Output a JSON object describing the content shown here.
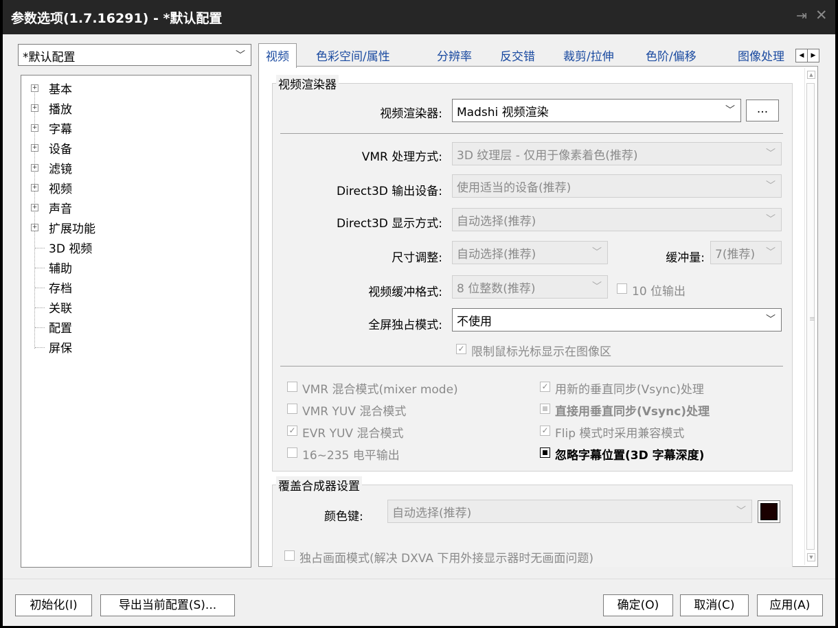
{
  "window": {
    "title": "参数选项(1.7.16291) - *默认配置",
    "pin_icon": "pin-icon",
    "close_icon": "close-icon"
  },
  "profile_select": {
    "value": "*默认配置"
  },
  "tree": {
    "items": [
      {
        "label": "基本",
        "expandable": true
      },
      {
        "label": "播放",
        "expandable": true
      },
      {
        "label": "字幕",
        "expandable": true
      },
      {
        "label": "设备",
        "expandable": true
      },
      {
        "label": "滤镜",
        "expandable": true
      },
      {
        "label": "视频",
        "expandable": true,
        "selected": true
      },
      {
        "label": "声音",
        "expandable": true
      },
      {
        "label": "扩展功能",
        "expandable": true
      },
      {
        "label": "3D 视频",
        "expandable": false
      },
      {
        "label": "辅助",
        "expandable": false
      },
      {
        "label": "存档",
        "expandable": false
      },
      {
        "label": "关联",
        "expandable": false
      },
      {
        "label": "配置",
        "expandable": false
      },
      {
        "label": "屏保",
        "expandable": false
      }
    ]
  },
  "tabs": [
    "视频",
    "色彩空间/属性",
    "分辨率",
    "反交错",
    "裁剪/拉伸",
    "色阶/偏移",
    "图像处理"
  ],
  "active_tab": "视频",
  "renderer_group": {
    "title": "视频渲染器",
    "renderer_label": "视频渲染器:",
    "renderer_value": "Madshi 视频渲染",
    "more_button": "...",
    "vmr_label": "VMR 处理方式:",
    "vmr_value": "3D 纹理层 - 仅用于像素着色(推荐)",
    "d3d_device_label": "Direct3D 输出设备:",
    "d3d_device_value": "使用适当的设备(推荐)",
    "d3d_display_label": "Direct3D 显示方式:",
    "d3d_display_value": "自动选择(推荐)",
    "resize_label": "尺寸调整:",
    "resize_value": "自动选择(推荐)",
    "buffer_label": "缓冲量:",
    "buffer_value": "7(推荐)",
    "buffer_format_label": "视频缓冲格式:",
    "buffer_format_value": "8 位整数(推荐)",
    "ten_bit_label": "10 位输出",
    "fullscreen_label": "全屏独占模式:",
    "fullscreen_value": "不使用",
    "limit_cursor_label": "限制鼠标光标显示在图像区"
  },
  "options_left": [
    {
      "label": "VMR 混合模式(mixer mode)",
      "state": "unchecked"
    },
    {
      "label": "VMR YUV 混合模式",
      "state": "unchecked"
    },
    {
      "label": "EVR YUV 混合模式",
      "state": "checked"
    },
    {
      "label": "16~235 电平输出",
      "state": "unchecked"
    }
  ],
  "options_right": [
    {
      "label": "用新的垂直同步(Vsync)处理",
      "state": "checked",
      "bold": false,
      "enabled": false
    },
    {
      "label": "直接用垂直同步(Vsync)处理",
      "state": "indeterminate",
      "bold": true,
      "enabled": false
    },
    {
      "label": "Flip 模式时采用兼容模式",
      "state": "checked",
      "bold": false,
      "enabled": false
    },
    {
      "label": "忽略字幕位置(3D 字幕深度)",
      "state": "indeterminate",
      "bold": true,
      "enabled": true
    }
  ],
  "overlay_group": {
    "title": "覆盖合成器设置",
    "color_key_label": "颜色键:",
    "color_key_value": "自动选择(推荐)",
    "color_key_swatch": "#1a0000",
    "exclusive_label": "独占画面模式(解决 DXVA 下用外接显示器时无画面问题)"
  },
  "buttons": {
    "init": "初始化(I)",
    "export": "导出当前配置(S)...",
    "ok": "确定(O)",
    "cancel": "取消(C)",
    "apply": "应用(A)"
  }
}
